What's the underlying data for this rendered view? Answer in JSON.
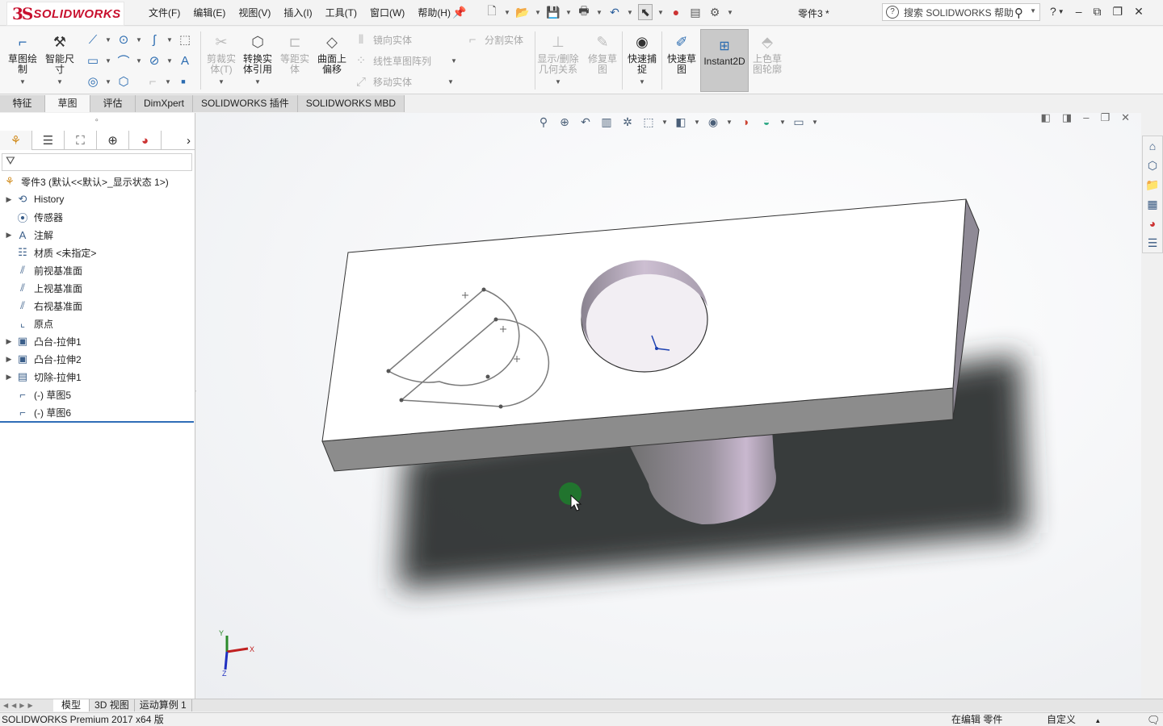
{
  "app": {
    "brand_ds": "3S",
    "brand_name": "SOLIDWORKS",
    "doc_title": "零件3 *"
  },
  "menu": [
    "文件(F)",
    "编辑(E)",
    "视图(V)",
    "插入(I)",
    "工具(T)",
    "窗口(W)",
    "帮助(H)"
  ],
  "search": {
    "placeholder": "搜索 SOLIDWORKS 帮助"
  },
  "ribbon": {
    "sketch": "草图绘\n制",
    "smart_dim": "智能尺\n寸",
    "trim": "剪裁实\n体(T)",
    "convert": "转换实\n体引用",
    "offset": "等距实\n体",
    "surface_offset": "曲面上\n偏移",
    "mirror": "镜向实体",
    "linear_pattern": "线性草图阵列",
    "move": "移动实体",
    "split": "分割实体",
    "show_relations": "显示/删除\n几何关系",
    "repair": "修复草\n图",
    "quick_snap": "快速捕\n捉",
    "rapid_sketch": "快速草\n图",
    "instant2d": "Instant2D",
    "shaded_contours": "上色草\n图轮廓"
  },
  "command_tabs": [
    "特征",
    "草图",
    "评估",
    "DimXpert",
    "SOLIDWORKS 插件",
    "SOLIDWORKS MBD"
  ],
  "active_command_tab": 1,
  "tree": {
    "root": "零件3  (默认<<默认>_显示状态 1>)",
    "items": [
      {
        "label": "History",
        "exp": "▶",
        "icon": "history-icon"
      },
      {
        "label": "传感器",
        "exp": "",
        "icon": "sensor-icon"
      },
      {
        "label": "注解",
        "exp": "▶",
        "icon": "annotation-icon"
      },
      {
        "label": "材质 <未指定>",
        "exp": "",
        "icon": "material-icon"
      },
      {
        "label": "前视基准面",
        "exp": "",
        "icon": "plane-icon"
      },
      {
        "label": "上视基准面",
        "exp": "",
        "icon": "plane-icon"
      },
      {
        "label": "右视基准面",
        "exp": "",
        "icon": "plane-icon"
      },
      {
        "label": "原点",
        "exp": "",
        "icon": "origin-icon"
      },
      {
        "label": "凸台-拉伸1",
        "exp": "▶",
        "icon": "boss-extrude-icon"
      },
      {
        "label": "凸台-拉伸2",
        "exp": "▶",
        "icon": "boss-extrude-icon"
      },
      {
        "label": "切除-拉伸1",
        "exp": "▶",
        "icon": "cut-extrude-icon"
      },
      {
        "label": "(-) 草图5",
        "exp": "",
        "icon": "sketch-icon"
      },
      {
        "label": "(-) 草图6",
        "exp": "",
        "icon": "sketch-icon"
      }
    ]
  },
  "triad": {
    "x": "X",
    "y": "Y",
    "z": "Z"
  },
  "bottom_tabs": [
    "模型",
    "3D 视图",
    "运动算例 1"
  ],
  "status": {
    "product": "SOLIDWORKS Premium 2017 x64 版",
    "mode": "在编辑 零件",
    "units": "自定义"
  },
  "colors": {
    "brand": "#c8102e",
    "accent": "#2a6bb0",
    "part_top": "#ffffff",
    "part_side": "#8a8a8a"
  }
}
